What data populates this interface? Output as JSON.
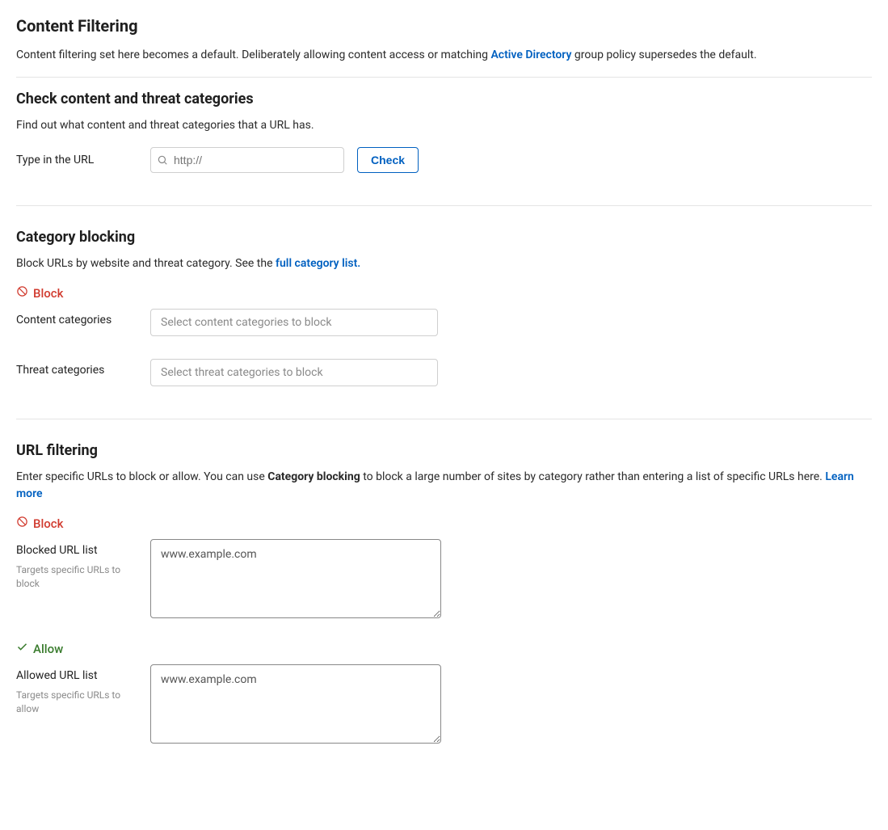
{
  "page": {
    "title": "Content Filtering",
    "description_pre": "Content filtering set here becomes a default. Deliberately allowing content access or matching ",
    "active_directory_link": "Active Directory",
    "description_post": " group policy supersedes the default."
  },
  "check": {
    "title": "Check content and threat categories",
    "description": "Find out what content and threat categories that a URL has.",
    "input_label": "Type in the URL",
    "input_placeholder": "http://",
    "button_label": "Check"
  },
  "category_blocking": {
    "title": "Category blocking",
    "description_pre": "Block URLs by website and threat category. See the",
    "full_list_link": " full category list.",
    "block_label": "Block",
    "content_label": "Content categories",
    "content_placeholder": "Select content categories to block",
    "threat_label": "Threat categories",
    "threat_placeholder": "Select threat categories to block"
  },
  "url_filtering": {
    "title": "URL filtering",
    "description_pre": "Enter specific URLs to block or allow. You can use ",
    "description_bold": "Category blocking",
    "description_post": " to block a large number of sites by category rather than entering a list of specific URLs here. ",
    "learn_more_link": "Learn more",
    "block_label": "Block",
    "blocked_label": "Blocked URL list",
    "blocked_hint": "Targets specific URLs to block",
    "blocked_placeholder": "www.example.com",
    "allow_label": "Allow",
    "allowed_label": "Allowed URL list",
    "allowed_hint": "Targets specific URLs to allow",
    "allowed_placeholder": "www.example.com"
  }
}
